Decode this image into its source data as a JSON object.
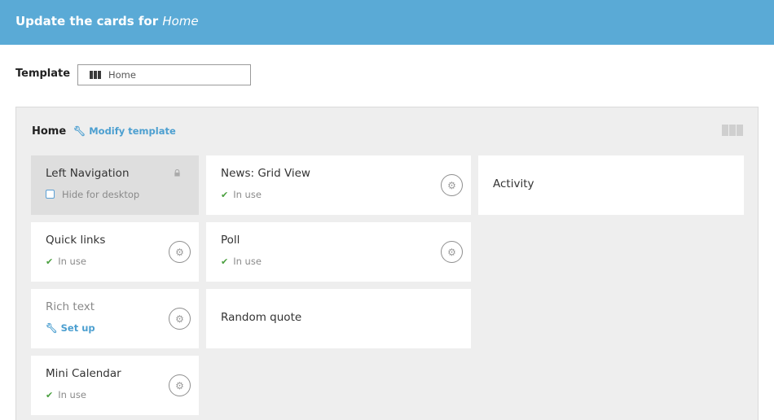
{
  "header": {
    "title_prefix": "Update the cards for ",
    "title_page": "Home"
  },
  "template": {
    "label": "Template",
    "selected": "Home"
  },
  "panel": {
    "title": "Home",
    "modify_label": "Modify template"
  },
  "cards": {
    "left_navigation": {
      "title": "Left Navigation",
      "option": "Hide for desktop"
    },
    "news_grid": {
      "title": "News: Grid View",
      "status": "In use"
    },
    "activity": {
      "title": "Activity"
    },
    "quick_links": {
      "title": "Quick links",
      "status": "In use"
    },
    "poll": {
      "title": "Poll",
      "status": "In use"
    },
    "rich_text": {
      "title": "Rich text",
      "action": "Set up"
    },
    "random_quote": {
      "title": "Random quote"
    },
    "mini_calendar": {
      "title": "Mini Calendar",
      "status": "In use"
    }
  },
  "icons": {
    "columns": "columns-icon",
    "wrench": "wrench-icon",
    "gear": "gear-icon",
    "check": "check-icon",
    "lock": "lock-icon"
  },
  "colors": {
    "header_bg": "#5aaad6",
    "link": "#4c9fd0",
    "check_green": "#4aa03f",
    "panel_bg": "#eeeeee",
    "locked_card_bg": "#dedede"
  }
}
